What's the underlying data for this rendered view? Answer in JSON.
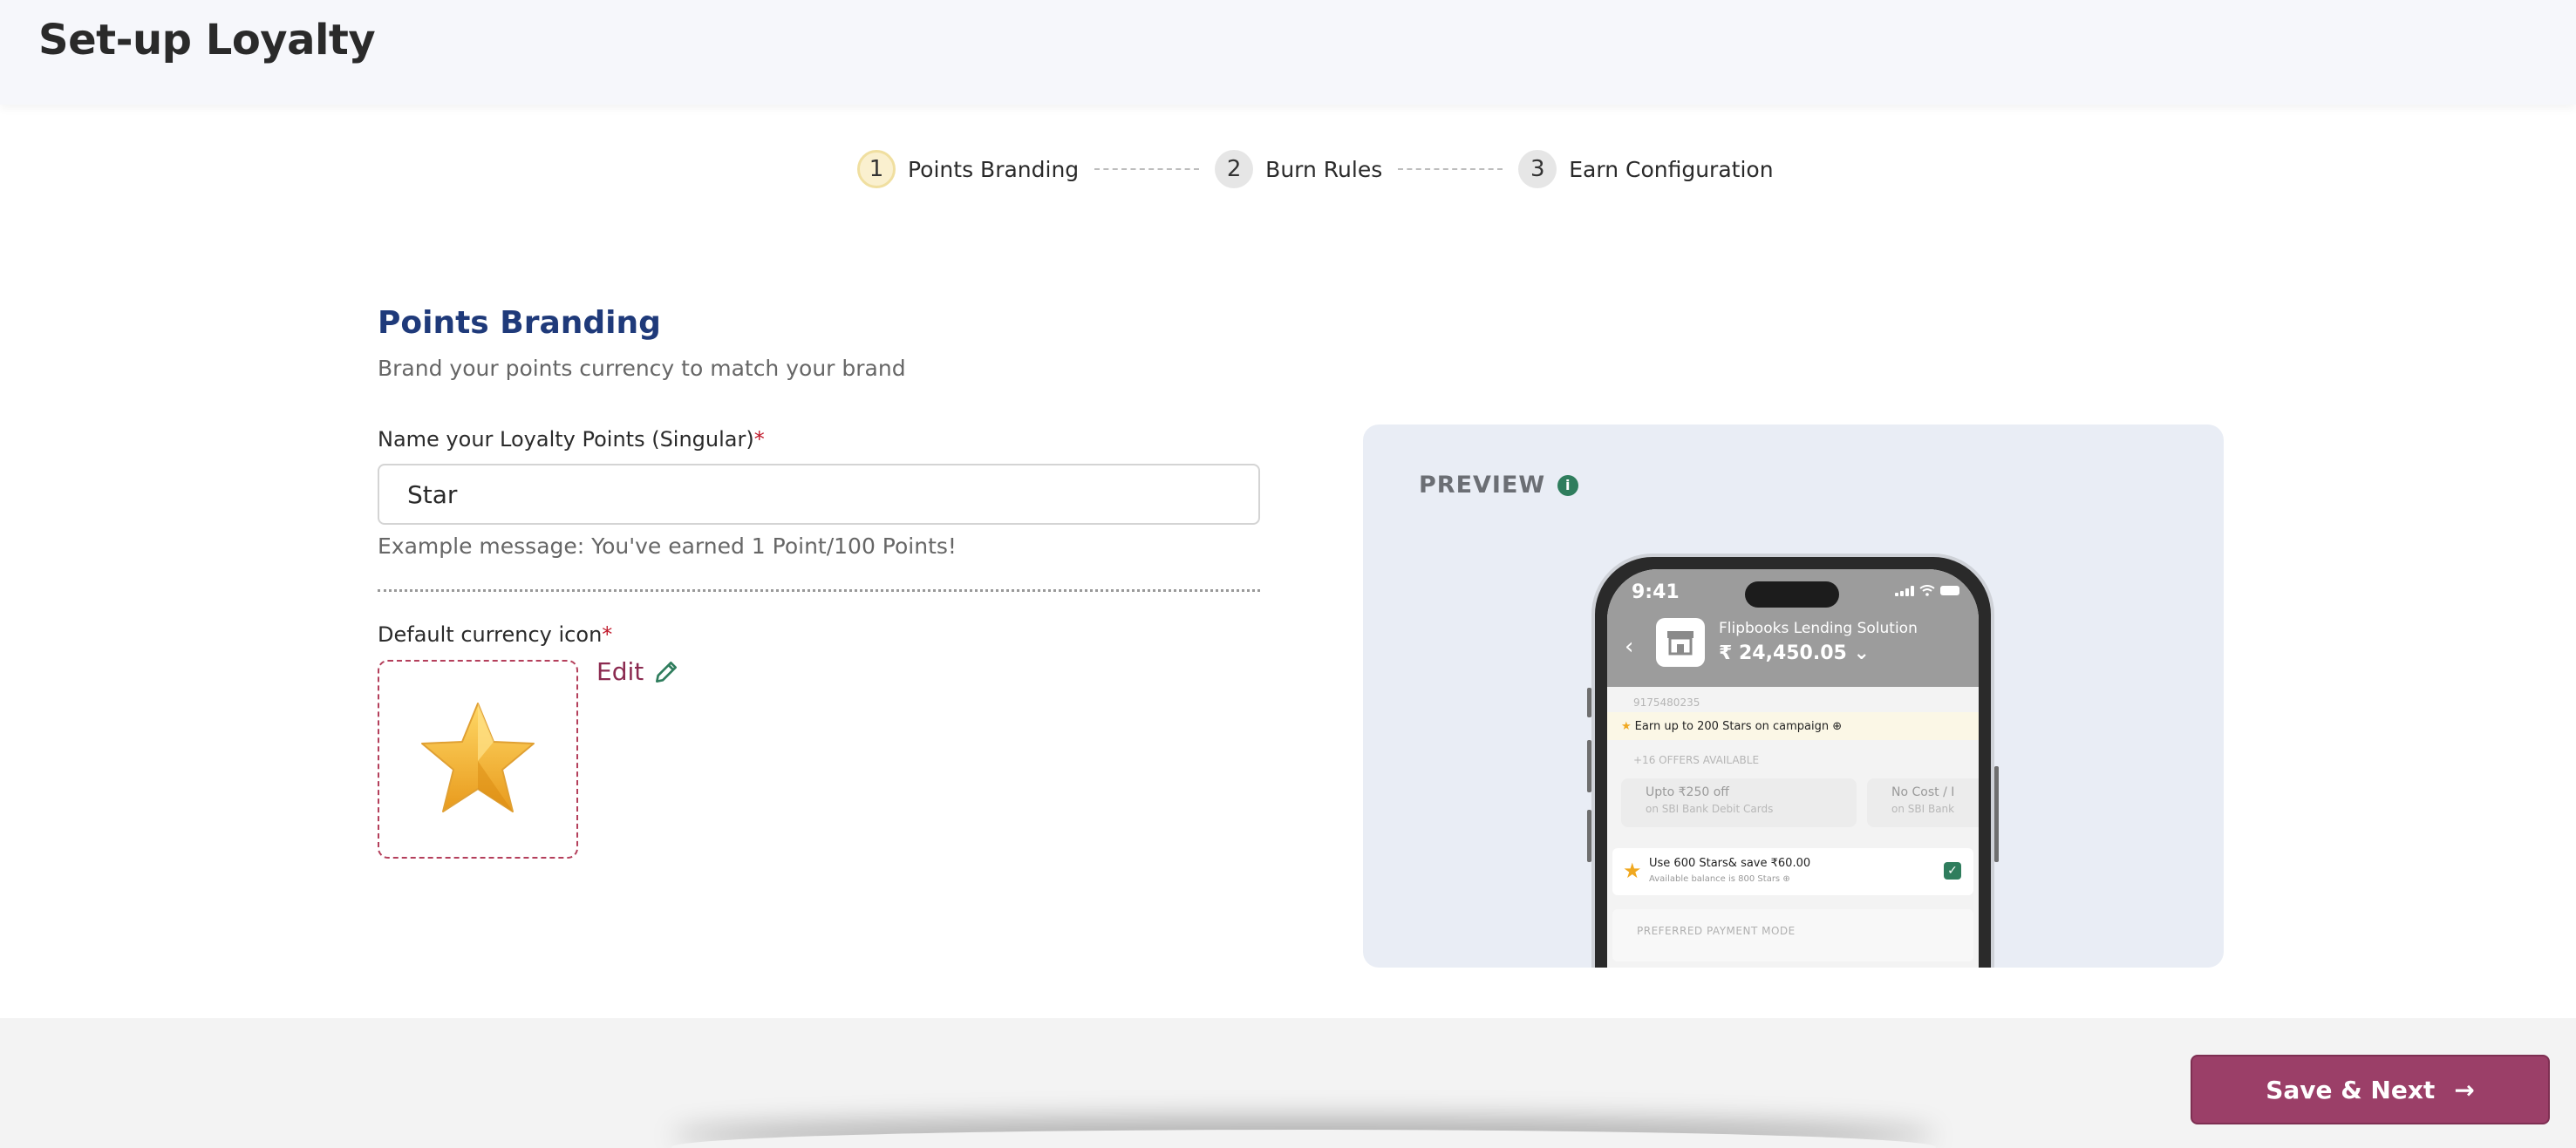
{
  "header": {
    "title": "Set-up Loyalty"
  },
  "stepper": {
    "steps": [
      {
        "number": "1",
        "label": "Points Branding"
      },
      {
        "number": "2",
        "label": "Burn Rules"
      },
      {
        "number": "3",
        "label": "Earn Configuration"
      }
    ]
  },
  "form": {
    "title": "Points Branding",
    "subtitle": "Brand your points currency to match your brand",
    "name_label": "Name your Loyalty Points (Singular)",
    "required_mark": "*",
    "name_value": "Star",
    "example": "Example message: You've earned 1 Point/100 Points!",
    "icon_label": "Default currency icon",
    "edit_label": "Edit"
  },
  "preview": {
    "title": "PREVIEW",
    "info": "i",
    "phone": {
      "time": "9:41",
      "back": "‹",
      "merchant": "Flipbooks Lending Solution",
      "amount": "₹ 24,450.05 ⌄",
      "phone_number": "9175480235",
      "campaign": "Earn up to 200 Stars on campaign ⊕",
      "offers_count": "+16 OFFERS AVAILABLE",
      "offer1_title": "Upto ₹250 off",
      "offer1_sub": "on SBI Bank Debit Cards",
      "offer2_title": "No Cost / I",
      "offer2_sub": "on SBI Bank",
      "burn_title": "Use 600 Stars& save ₹60.00",
      "burn_sub": "Available balance is 800 Stars ⊕",
      "check": "✓",
      "pref": "PREFERRED PAYMENT MODE"
    }
  },
  "footer": {
    "save_label": "Save & Next",
    "arrow": "→"
  },
  "colors": {
    "accent": "#9b3f68",
    "title_blue": "#1f3a7a",
    "info_green": "#2f7d5d"
  }
}
